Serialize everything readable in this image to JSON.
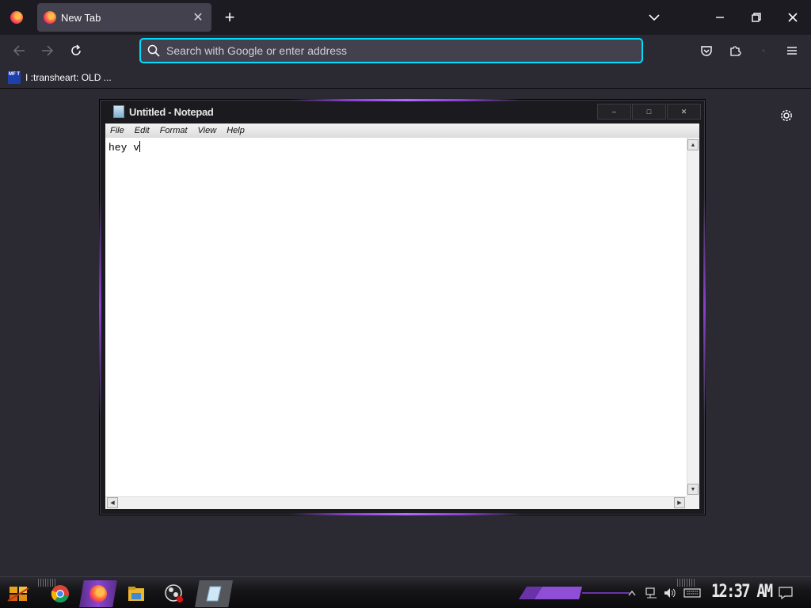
{
  "browser": {
    "tab": {
      "title": "New Tab"
    },
    "urlbar": {
      "placeholder": "Search with Google or enter address"
    },
    "bookmarks": [
      {
        "label": "I :transheart: OLD ...",
        "icon_text": "MF T"
      }
    ]
  },
  "notepad": {
    "title": "Untitled - Notepad",
    "menus": [
      "File",
      "Edit",
      "Format",
      "View",
      "Help"
    ],
    "content": "hey v"
  },
  "taskbar": {
    "apps": [
      "start-icon",
      "chrome-icon",
      "firefox-icon",
      "file-explorer-icon",
      "obs-icon",
      "notepad-icon"
    ],
    "clock": "12:37 AM"
  },
  "colors": {
    "urlbar_focus": "#00ddff",
    "accent_purple": "#8a46cf",
    "tab_active": "#42414d"
  }
}
